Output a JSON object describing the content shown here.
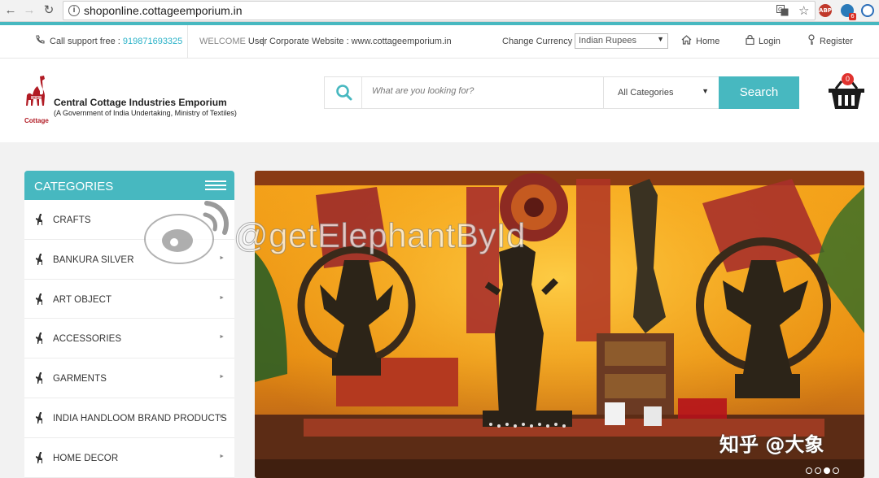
{
  "browser": {
    "url": "shoponline.cottageemporium.in",
    "back_icon": "arrow-left",
    "forward_icon": "arrow-right",
    "reload_icon": "reload",
    "extensions": [
      {
        "name": "translate-icon"
      },
      {
        "name": "star-icon"
      },
      {
        "name": "abp-extension-icon",
        "label": "ABP",
        "color": "#c0392b"
      },
      {
        "name": "extension-badge-icon",
        "badge": "6",
        "color": "#2a7ab9"
      },
      {
        "name": "profile-icon",
        "color": "#2a6db8"
      }
    ]
  },
  "topbar": {
    "support_label": "Call support free : ",
    "support_phone": "919871693325",
    "welcome_prefix": "WELCOME",
    "welcome_user": " User",
    "separator": "|",
    "corporate_label": "Corporate Website : www.cottageemporium.in",
    "currency_label": "Change Currency :",
    "currency_value": "Indian Rupees",
    "home": "Home",
    "login": "Login",
    "register": "Register"
  },
  "header": {
    "logo_title": "Central Cottage Industries Emporium",
    "logo_subtitle": "(A Government of India Undertaking, Ministry of Textiles)",
    "logo_tag": "Cottage",
    "search_placeholder": "What are you looking for?",
    "category_select": "All Categories",
    "search_button": "Search",
    "cart_count": "0",
    "accent_color": "#47b8c0"
  },
  "sidebar": {
    "title": "CATEGORIES",
    "items": [
      {
        "label": "CRAFTS"
      },
      {
        "label": "BANKURA SILVER"
      },
      {
        "label": "ART OBJECT"
      },
      {
        "label": "ACCESSORIES"
      },
      {
        "label": "GARMENTS"
      },
      {
        "label": "INDIA HANDLOOM BRAND PRODUCTS"
      },
      {
        "label": "HOME DECOR"
      }
    ]
  },
  "banner": {
    "slides": 4,
    "active_slide": 3
  },
  "watermark": {
    "handle": "@getElephantById",
    "credit": "知乎 @大象"
  }
}
